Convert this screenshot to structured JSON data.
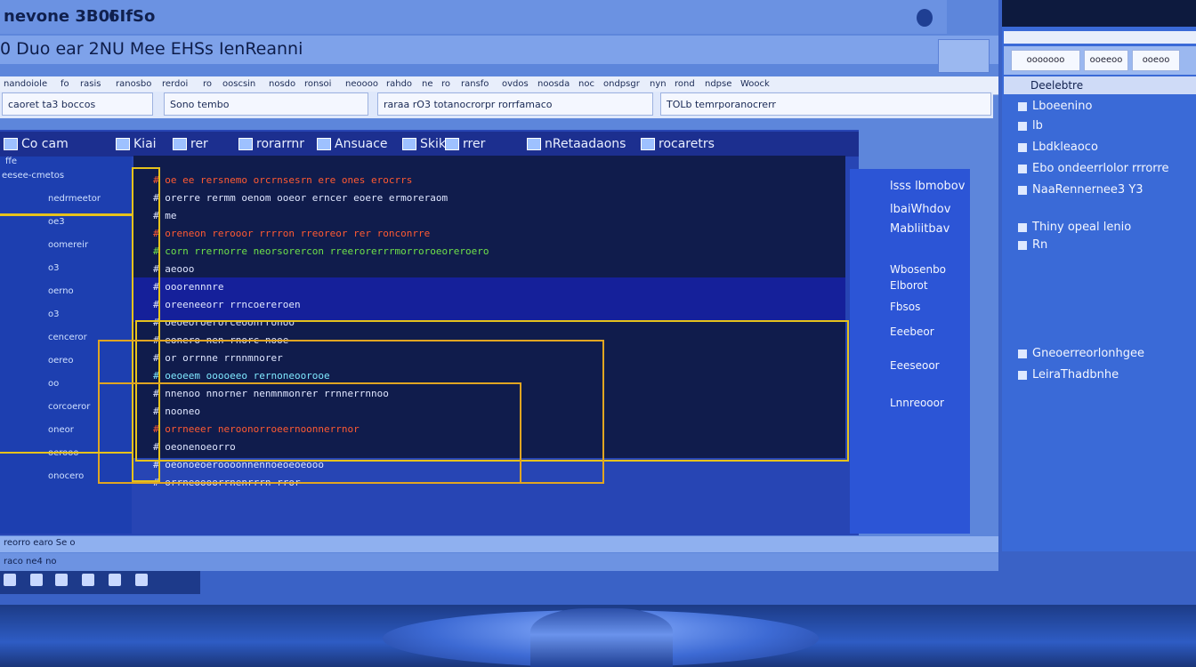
{
  "window": {
    "title": "nevone 3B0I",
    "title2": "6IfSo",
    "menu_text": "0  Duo ear  2NU Mee   EHSs  IenReanni"
  },
  "toolbar": {
    "items": [
      "nandoiole",
      "fo",
      "rasis",
      "ranosbo",
      "rerdoi",
      "ro",
      "ooscsin",
      "nosdo",
      "ronsoi",
      "neoooo",
      "rahdo",
      "ne",
      "ro",
      "ransfo",
      "ovdos",
      "noosda",
      "noc",
      "ondpsgr",
      "nyn",
      "rond",
      "ndpse",
      "Woock"
    ]
  },
  "address": {
    "field1": "caoret  ta3  boccos",
    "field2": "Sono  tembo",
    "field3": "raraa  rO3  totanocrorpr  rorrfamaco",
    "field4": "TOLb  temrporanocrerr"
  },
  "tabs": [
    {
      "label": "Co  cam"
    },
    {
      "label": "Kiai"
    },
    {
      "label": "rer"
    },
    {
      "label": "rorarrnr"
    },
    {
      "label": "Ansuace"
    },
    {
      "label": "Skikes"
    },
    {
      "label": "rrer"
    },
    {
      "label": "nRetaadaons"
    },
    {
      "label": "rocaretrs"
    }
  ],
  "tree": {
    "header": "ffe",
    "items": [
      "eesee-cmetos",
      "nedrmeetor",
      "oe3",
      "oomereir",
      "o3",
      "oerno",
      "o3",
      "cenceror",
      "oereo",
      "oo",
      "corcoeror",
      "oneor",
      "oerooo",
      "onocero"
    ]
  },
  "code": {
    "lines": [
      "# oe  ee  rersnemo  orcrnsesrn  ere  ones  erocrrs",
      "# orerre  rermm  oenom  ooeor  erncer  eoere  ermoreraom",
      "#  me",
      "#  oreneon  rerooor  rrrron  rreoreor  rer  ronconrre",
      "# corn  rrernorre  neorsorercon  rreerorerrrmorroroeoreroero",
      "#  aeooo",
      "#  ooorennnre",
      "#  oreeneeorr  rrncoereroen",
      "#  oeoeoroerorceoonrronoo",
      "#  eonero  nen  rnorc  nooe",
      "#  or  orrnne  rrnnmnorer",
      "#  oeoeem  ooooeeo  rernoneoorooe",
      "#  nnenoo  nnorner  nenmnmonrer  rrnnerrnnoo",
      "#  nooneo",
      "#  orrneeer  neroonorroeernoonnerrnor",
      "#  oeonenoeorro",
      "#  oeonoeoeroooonnennoeoeoeooo",
      "#  orrneoooorrnenrrrn  rror"
    ]
  },
  "rightpanel": {
    "items": [
      "lsss  lbmobov",
      "lbaiWhdov",
      "Mabliitbav",
      "Wbosenbo",
      "Elborot",
      "Fbsos",
      "Eeebeor",
      "Eeeseoor",
      "Lnnreooor"
    ]
  },
  "status": {
    "text": "reorro  earo  Se  o",
    "task": "raco  ne4  no"
  },
  "side": {
    "buttons": [
      "ooooooo",
      "ooeeoo",
      "ooeoo"
    ],
    "header": "Deelebtre",
    "items": [
      "Lboeenino",
      "lb",
      "Lbdkleaoco",
      "Ebo  ondeerrlolor  rrrorre",
      "NaaRennernee3  Y3",
      "Thiny  opeal  lenio",
      "Rn",
      "Gneoerreorlonhgee",
      "LeiraThadbnhe"
    ]
  },
  "colors": {
    "screen_bg": "#3a62c6",
    "code_bg": "#101c4c",
    "highlight": "#e6c21c",
    "code_red": "#ff5a32",
    "code_green": "#6ee04a",
    "code_white": "#dfe6ff"
  }
}
